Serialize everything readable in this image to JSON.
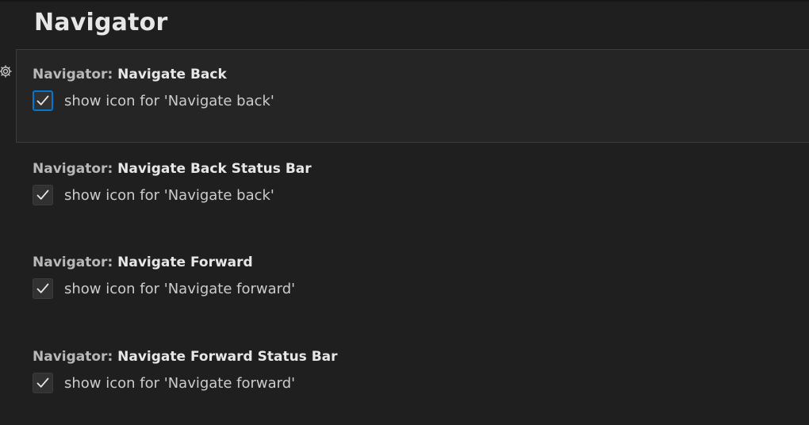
{
  "section": {
    "title": "Navigator"
  },
  "settings": [
    {
      "category": "Navigator: ",
      "name": "Navigate Back",
      "checked": true,
      "label": "show icon for 'Navigate back'"
    },
    {
      "category": "Navigator: ",
      "name": "Navigate Back Status Bar",
      "checked": true,
      "label": "show icon for 'Navigate back'"
    },
    {
      "category": "Navigator: ",
      "name": "Navigate Forward",
      "checked": true,
      "label": "show icon for 'Navigate forward'"
    },
    {
      "category": "Navigator: ",
      "name": "Navigate Forward Status Bar",
      "checked": true,
      "label": "show icon for 'Navigate forward'"
    }
  ],
  "icons": {
    "gear": "gear-icon",
    "check": "check-icon"
  },
  "colors": {
    "background": "#1f1f1f",
    "focused_background": "#252526",
    "focus_border": "#0078d4"
  }
}
